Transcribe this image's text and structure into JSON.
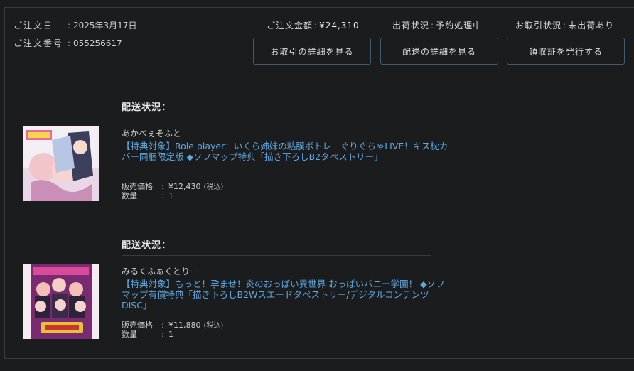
{
  "order": {
    "date_label": "ご注文日",
    "date_value": "2025年3月17日",
    "number_label": "ご注文番号",
    "number_value": "055256617",
    "total_label": "ご注文金額",
    "total_value": "¥24,310",
    "shipping_status_label": "出荷状況",
    "shipping_status_value": "予約処理中",
    "transaction_status_label": "お取引状況",
    "transaction_status_value": "未出荷あり"
  },
  "buttons": {
    "transaction_details": "お取引の詳細を見る",
    "delivery_details": "配送の詳細を見る",
    "receipt": "領収証を発行する"
  },
  "items": [
    {
      "status_title": "配送状況：",
      "maker": "あかべぇそふと",
      "title": "【特典対象】Role player：いくら姉妹の粘膜ボトレ　ぐりぐちゃLIVE！キス枕カバー同梱限定版 ◆ソフマップ特典「描き下ろしB2タペストリー」",
      "price_label": "販売価格",
      "price_value": "¥12,430",
      "tax_note": "(税込)",
      "qty_label": "数量",
      "qty_value": "1"
    },
    {
      "status_title": "配送状況：",
      "maker": "みるくふぁくとりー",
      "title": "【特典対象】もっと！孕ませ！炎のおっぱい異世界 おっぱいバニー学園！ ◆ソフマップ有償特典「描き下ろしB2Wスエードタペストリー/デジタルコンテンツDISC」",
      "price_label": "販売価格",
      "price_value": "¥11,880",
      "tax_note": "(税込)",
      "qty_label": "数量",
      "qty_value": "1"
    }
  ],
  "colors": {
    "background": "#1b1c1e",
    "border": "#3a3b3d",
    "link": "#5fa8e0",
    "button_border": "#44596a"
  }
}
